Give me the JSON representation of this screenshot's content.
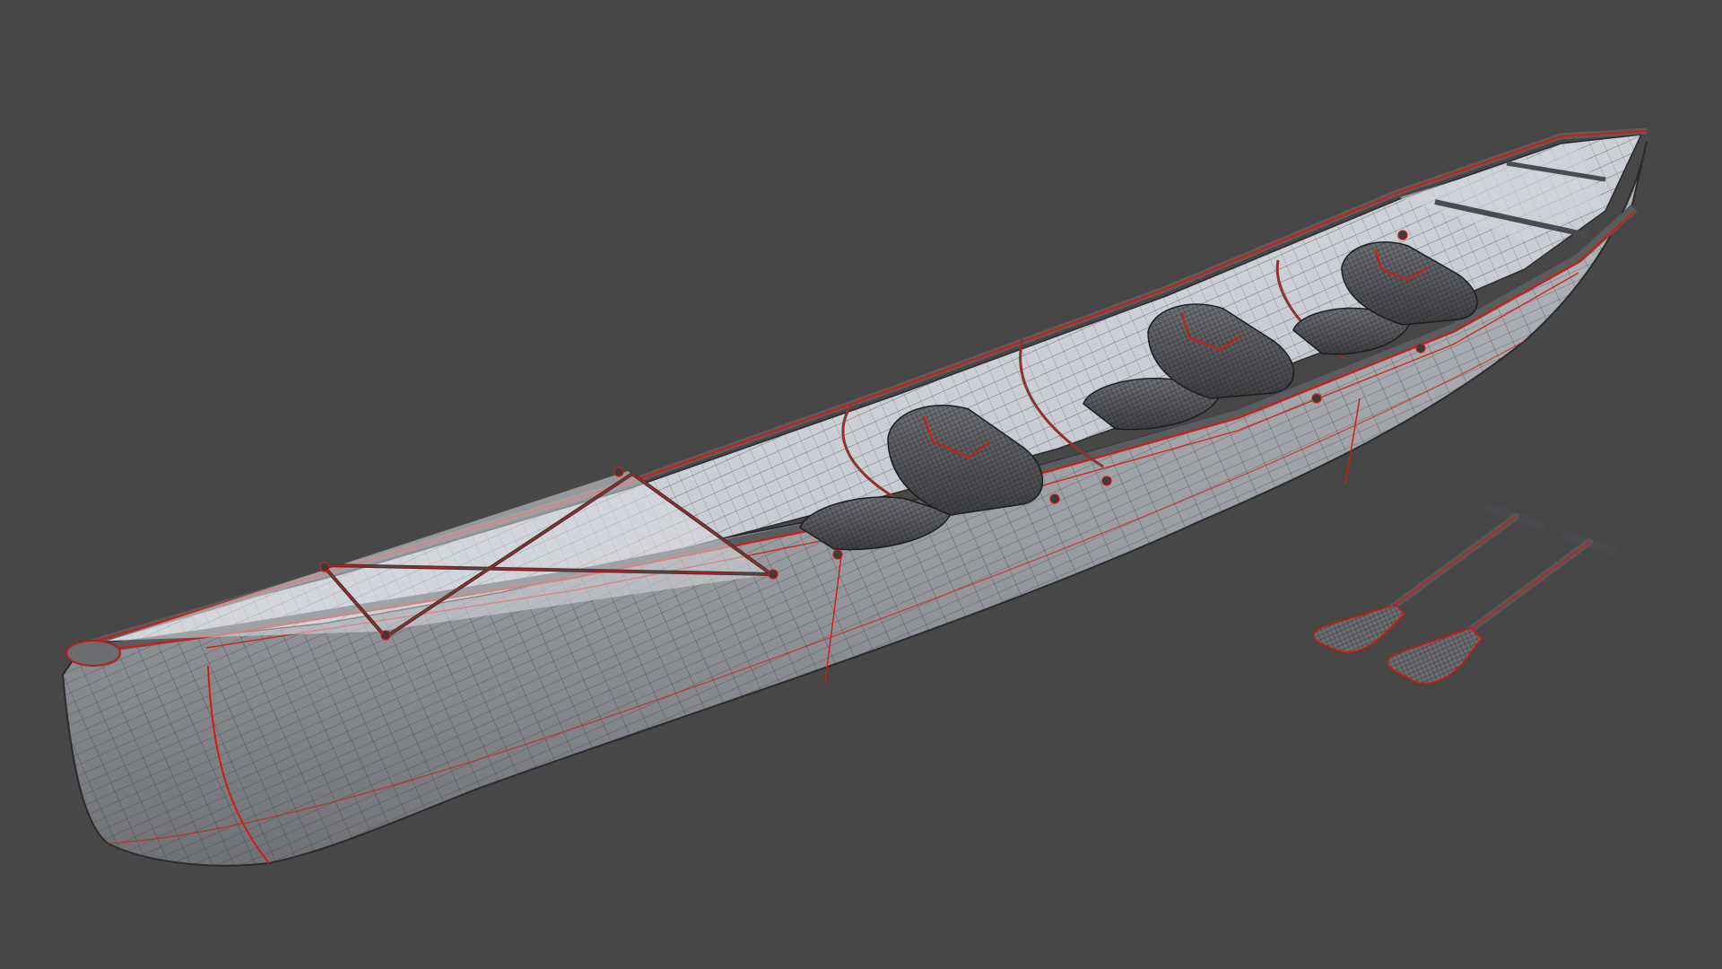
{
  "scene": {
    "background_color": "#474747",
    "mesh_color": "#a9abb0",
    "mesh_light_color": "#dfe2e7",
    "mesh_dark_color": "#55575b",
    "wire_color": "#2a2b2d",
    "seam_color": "#d41a12",
    "objects": [
      {
        "name": "canoe-hull",
        "kind": "canoe",
        "seats": 3
      },
      {
        "name": "paddle",
        "kind": "paddle",
        "count": 2
      }
    ]
  }
}
